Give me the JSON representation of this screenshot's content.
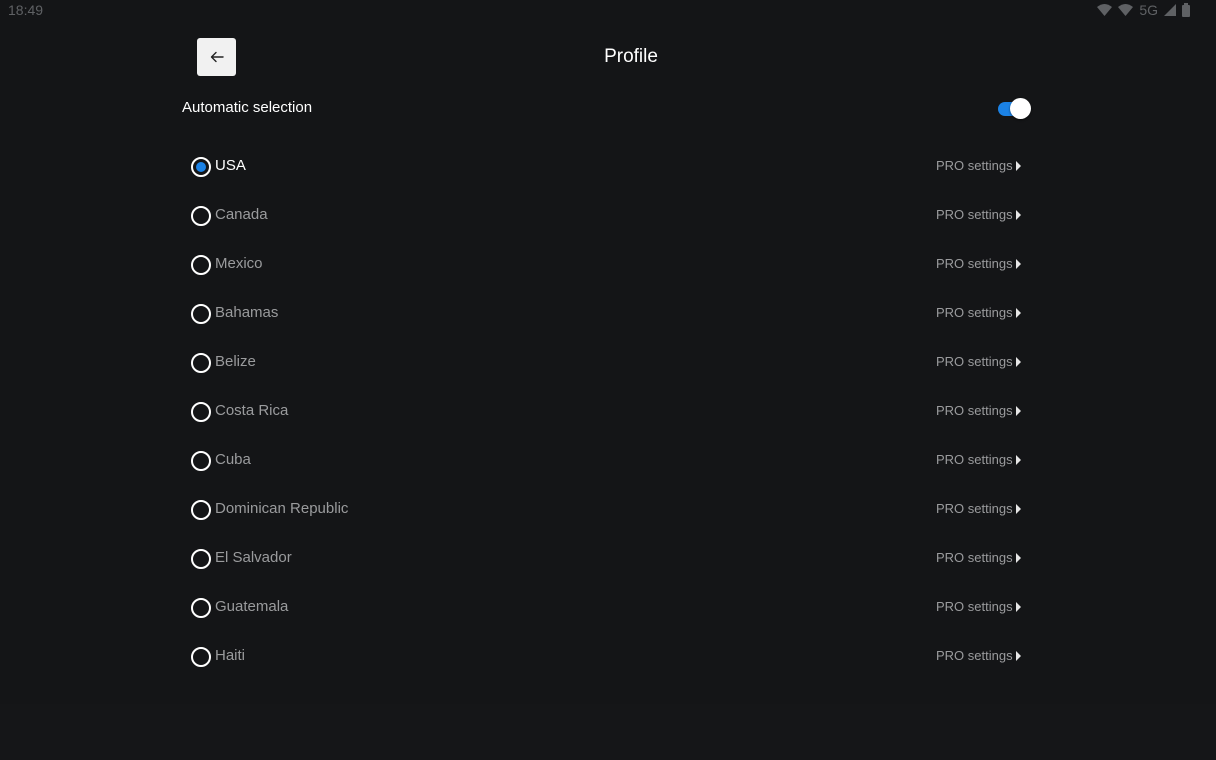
{
  "status_bar": {
    "time": "18:49",
    "network": "5G"
  },
  "header": {
    "title": "Profile",
    "back_icon": "arrow-left-icon"
  },
  "automatic_selection": {
    "label": "Automatic selection",
    "enabled": true
  },
  "colors": {
    "accent": "#1b82e6",
    "background": "#141517",
    "muted_text": "#9a9b9d"
  },
  "countries": [
    {
      "name": "USA",
      "selected": true,
      "action": "PRO settings"
    },
    {
      "name": "Canada",
      "selected": false,
      "action": "PRO settings"
    },
    {
      "name": "Mexico",
      "selected": false,
      "action": "PRO settings"
    },
    {
      "name": "Bahamas",
      "selected": false,
      "action": "PRO settings"
    },
    {
      "name": "Belize",
      "selected": false,
      "action": "PRO settings"
    },
    {
      "name": "Costa Rica",
      "selected": false,
      "action": "PRO settings"
    },
    {
      "name": "Cuba",
      "selected": false,
      "action": "PRO settings"
    },
    {
      "name": "Dominican Republic",
      "selected": false,
      "action": "PRO settings"
    },
    {
      "name": "El Salvador",
      "selected": false,
      "action": "PRO settings"
    },
    {
      "name": "Guatemala",
      "selected": false,
      "action": "PRO settings"
    },
    {
      "name": "Haiti",
      "selected": false,
      "action": "PRO settings"
    }
  ]
}
